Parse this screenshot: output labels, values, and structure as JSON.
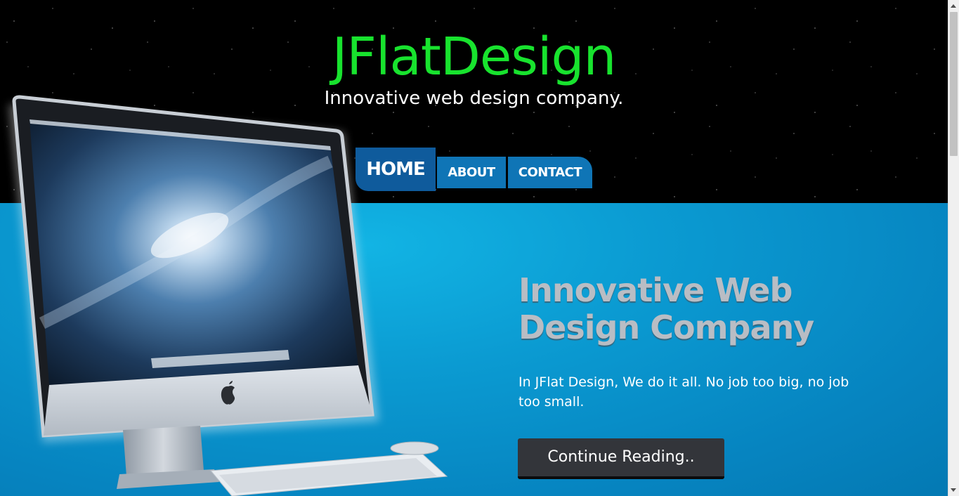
{
  "header": {
    "title": "JFlatDesign",
    "tagline": "Innovative web design company."
  },
  "nav": {
    "items": [
      {
        "label": "HOME",
        "active": true
      },
      {
        "label": "ABOUT",
        "active": false
      },
      {
        "label": "CONTACT",
        "active": false
      }
    ]
  },
  "hero": {
    "heading": "Innovative Web Design Company",
    "body": "In JFlat Design, We do it all. No job too big, no job too small.",
    "cta_label": "Continue Reading.."
  },
  "colors": {
    "title_green": "#18e32e",
    "nav_active": "#0f5b9c",
    "nav_item": "#0f75b6",
    "hero_blue": "#0684c0",
    "button_dark": "#33353a"
  },
  "icons": {
    "computer_illustration": "imac-computer-icon",
    "keyboard": "keyboard-icon",
    "brand_logo": "apple-logo-icon"
  }
}
